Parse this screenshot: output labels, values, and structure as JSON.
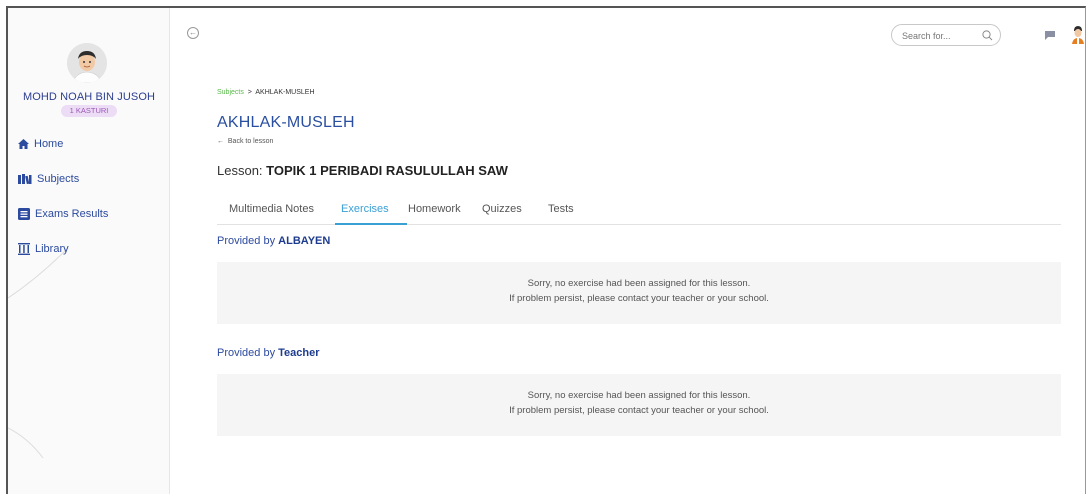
{
  "user": {
    "name": "MOHD NOAH BIN JUSOH",
    "class_badge": "1 KASTURI"
  },
  "sidebar": {
    "items": [
      {
        "label": "Home",
        "icon": "home-icon"
      },
      {
        "label": "Subjects",
        "icon": "book-icon"
      },
      {
        "label": "Exams Results",
        "icon": "list-icon"
      },
      {
        "label": "Library",
        "icon": "library-icon"
      }
    ]
  },
  "topbar": {
    "search_placeholder": "Search for...",
    "collapse_icon": "collapse-icon",
    "chat_icon": "chat-icon"
  },
  "breadcrumb": {
    "link": "Subjects",
    "separator": ">",
    "current": "AKHLAK-MUSLEH"
  },
  "subject": {
    "title": "AKHLAK-MUSLEH",
    "back_label": "Back to lesson"
  },
  "lesson": {
    "prefix": "Lesson: ",
    "name": "TOPIK 1 PERIBADI RASULULLAH SAW"
  },
  "tabs": [
    {
      "label": "Multimedia Notes",
      "active": false
    },
    {
      "label": "Exercises",
      "active": true
    },
    {
      "label": "Homework",
      "active": false
    },
    {
      "label": "Quizzes",
      "active": false
    },
    {
      "label": "Tests",
      "active": false
    }
  ],
  "sections": [
    {
      "provided_prefix": "Provided by ",
      "provider": "ALBAYEN",
      "message_line1": "Sorry, no exercise had been assigned for this lesson.",
      "message_line2": "If problem persist, please contact your teacher or your school."
    },
    {
      "provided_prefix": "Provided by ",
      "provider": "Teacher",
      "message_line1": "Sorry, no exercise had been assigned for this lesson.",
      "message_line2": "If problem persist, please contact your teacher or your school."
    }
  ],
  "colors": {
    "accent_blue": "#2a4fa0",
    "active_tab": "#3aa0d4",
    "breadcrumb_link": "#5ab94b",
    "badge_bg": "#ecdcf5",
    "badge_text": "#9b59b6"
  }
}
